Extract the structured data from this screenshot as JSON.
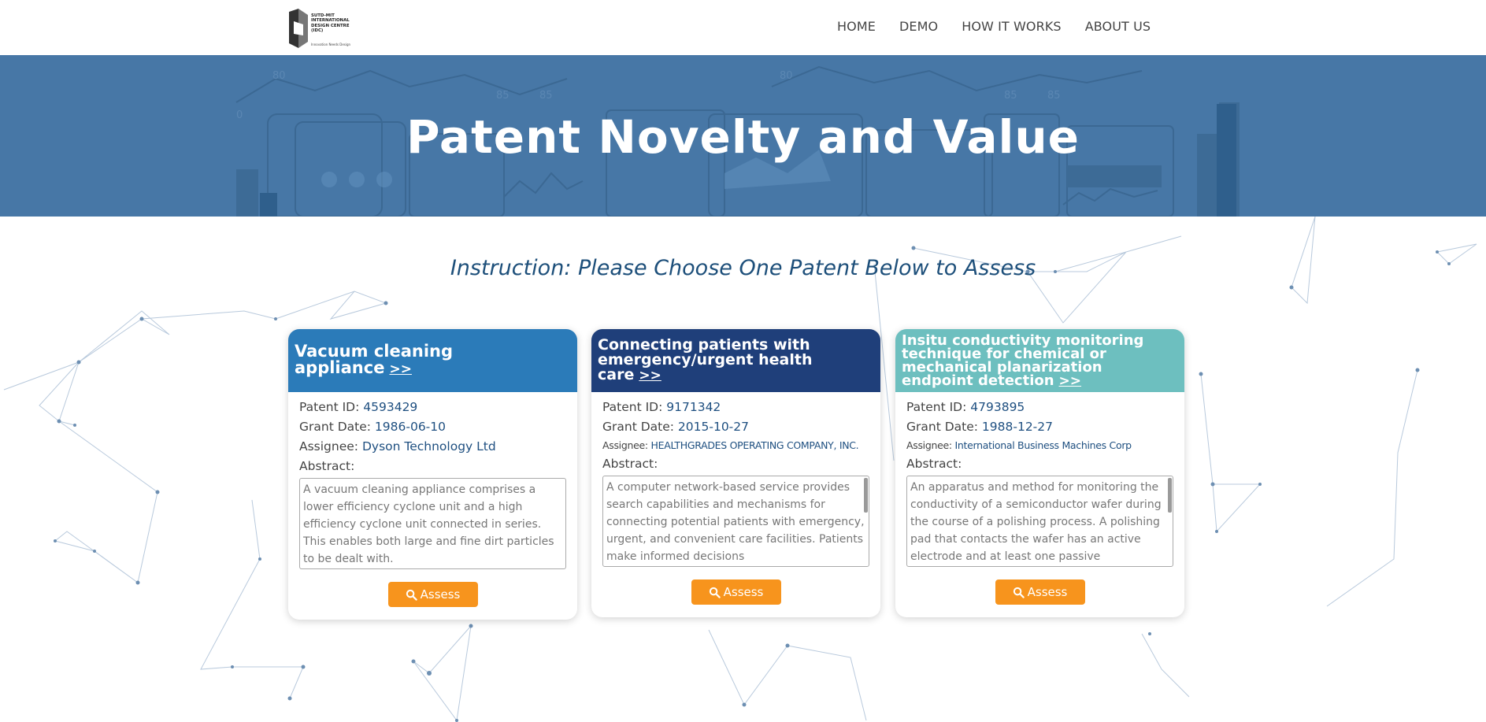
{
  "logo": {
    "text": "SUTD-MIT INTERNATIONAL DESIGN CENTRE (IDC)",
    "tagline": "Innovation Needs Design"
  },
  "nav": [
    {
      "label": "HOME"
    },
    {
      "label": "DEMO"
    },
    {
      "label": "HOW IT WORKS"
    },
    {
      "label": "ABOUT US"
    }
  ],
  "banner": {
    "title": "Patent Novelty and Value"
  },
  "instruction": "Instruction: Please Choose One Patent Below to Assess",
  "labels": {
    "patent_id": "Patent  ID:",
    "grant_date": "Grant  Date:",
    "assignee": "Assignee:",
    "abstract": "Abstract:",
    "assess": "Assess",
    "more": ">>"
  },
  "cards": [
    {
      "title": "Vacuum cleaning appliance",
      "color": "#2b7bb9",
      "patent_id": "4593429",
      "grant_date": "1986-06-10",
      "assignee": "Dyson  Technology  Ltd",
      "abstract": "A vacuum cleaning appliance comprises a lower efficiency cyclone unit and a high efficiency cyclone unit connected in series. This enables both large and fine dirt particles to be dealt with."
    },
    {
      "title": "Connecting patients with emergency/urgent health care",
      "color": "#1f3f7a",
      "patent_id": "9171342",
      "grant_date": "2015-10-27",
      "assignee": "HEALTHGRADES OPERATING COMPANY, INC.",
      "abstract": "A computer network-based service provides search capabilities and mechanisms for connecting potential patients with emergency, urgent, and convenient care facilities. Patients make informed decisions"
    },
    {
      "title": "Insitu conductivity monitoring technique for chemical or mechanical planarization endpoint detection",
      "color": "#6dbfbf",
      "patent_id": "4793895",
      "grant_date": "1988-12-27",
      "assignee": "International  Business  Machines  Corp",
      "abstract": "An apparatus and method for monitoring the conductivity of a semiconductor wafer during the course of a polishing process. A polishing pad that contacts the wafer has an active electrode and at least one passive"
    }
  ],
  "banner_numbers": [
    "80",
    "85",
    "85",
    "0",
    "80",
    "85",
    "85"
  ],
  "icons": {
    "search": "search-icon",
    "logo": "idc-logo-icon"
  }
}
